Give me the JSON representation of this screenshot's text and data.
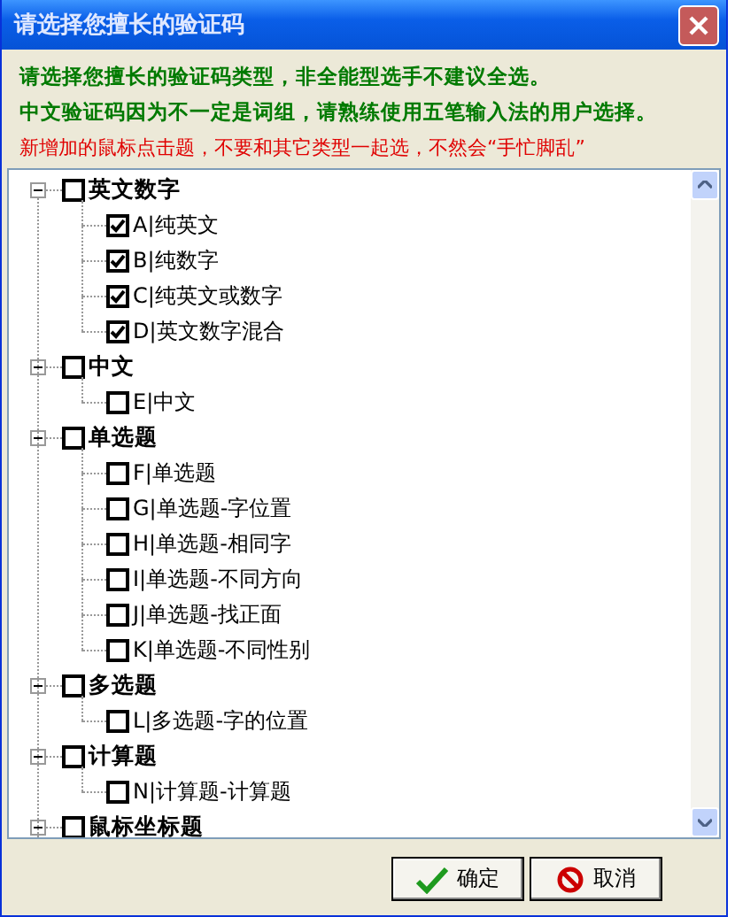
{
  "window": {
    "title": "请选择您擅长的验证码"
  },
  "messages": [
    {
      "text": "请选择您擅长的验证码类型，非全能型选手不建议全选。",
      "kind": "note"
    },
    {
      "text": "中文验证码因为不一定是词组，请熟练使用五笔输入法的用户选择。",
      "kind": "note"
    },
    {
      "text": "新增加的鼠标点击题，不要和其它类型一起选，不然会“手忙脚乱”",
      "kind": "warning"
    }
  ],
  "tree": [
    {
      "label": "英文数字",
      "expanded": true,
      "checked": false,
      "children": [
        {
          "label": "A|纯英文",
          "checked": true
        },
        {
          "label": "B|纯数字",
          "checked": true
        },
        {
          "label": "C|纯英文或数字",
          "checked": true
        },
        {
          "label": "D|英文数字混合",
          "checked": true
        }
      ]
    },
    {
      "label": "中文",
      "expanded": true,
      "checked": false,
      "children": [
        {
          "label": "E|中文",
          "checked": false
        }
      ]
    },
    {
      "label": "单选题",
      "expanded": true,
      "checked": false,
      "children": [
        {
          "label": "F|单选题",
          "checked": false
        },
        {
          "label": "G|单选题-字位置",
          "checked": false
        },
        {
          "label": "H|单选题-相同字",
          "checked": false
        },
        {
          "label": "I|单选题-不同方向",
          "checked": false
        },
        {
          "label": "J|单选题-找正面",
          "checked": false
        },
        {
          "label": "K|单选题-不同性别",
          "checked": false
        }
      ]
    },
    {
      "label": "多选题",
      "expanded": true,
      "checked": false,
      "children": [
        {
          "label": "L|多选题-字的位置",
          "checked": false
        }
      ]
    },
    {
      "label": "计算题",
      "expanded": true,
      "checked": false,
      "children": [
        {
          "label": "N|计算题-计算题",
          "checked": false
        }
      ]
    },
    {
      "label": "鼠标坐标题",
      "expanded": true,
      "checked": false
    }
  ],
  "buttons": [
    {
      "label": "确定",
      "kind": "ok"
    },
    {
      "label": "取消",
      "kind": "cancel"
    }
  ]
}
